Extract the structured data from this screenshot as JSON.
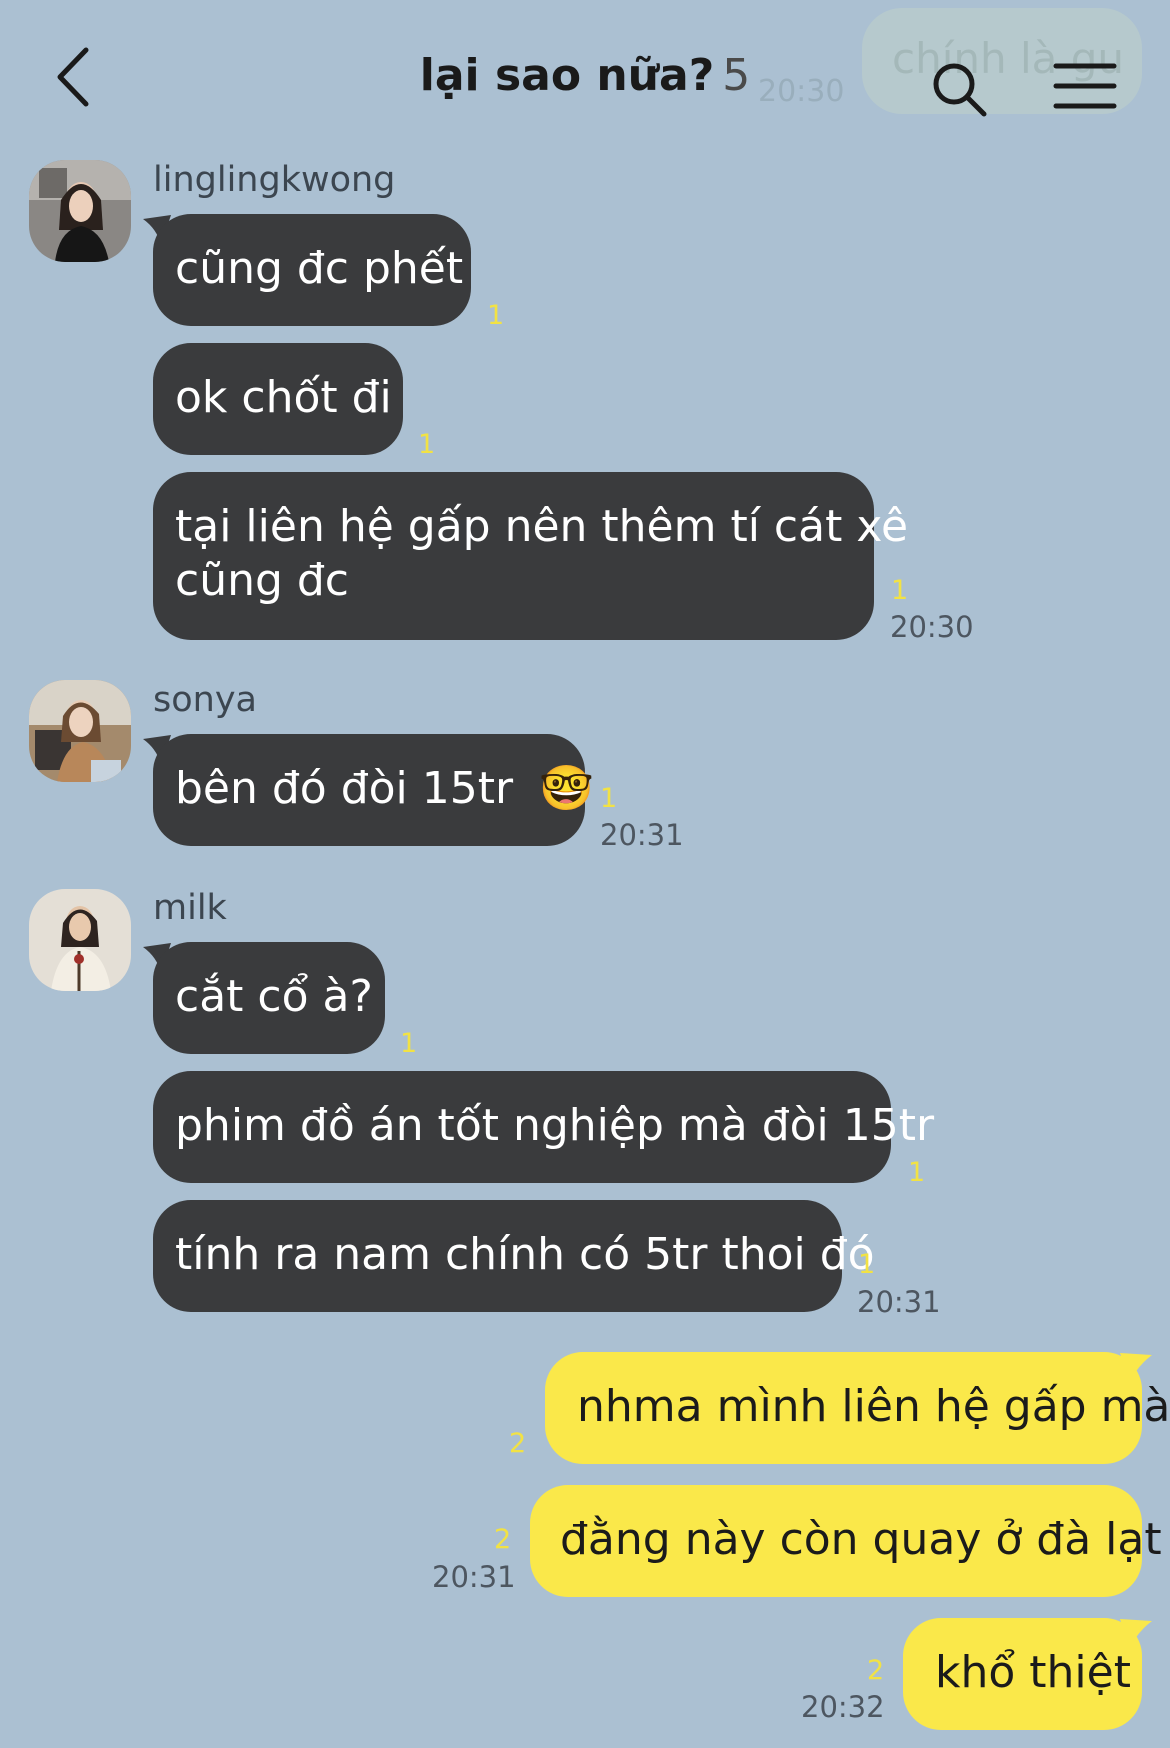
{
  "header": {
    "title": "lại sao nữa?",
    "member_count": "5",
    "back_icon": "chevron-left-icon",
    "search_icon": "search-icon",
    "menu_icon": "hamburger-menu-icon"
  },
  "overlay": {
    "preview_text": "chính là gu",
    "preview_time": "20:30"
  },
  "colors": {
    "background": "#abc0d2",
    "incoming_bubble": "#3a3b3d",
    "outgoing_bubble": "#fae84a",
    "unread_count": "#f2e244"
  },
  "groups": [
    {
      "sender": "linglingkwong",
      "messages": [
        {
          "text": "cũng đc phết",
          "unread": "1"
        },
        {
          "text": "ok chốt đi",
          "unread": "1"
        },
        {
          "text_line1": "tại liên hệ gấp nên thêm tí cát xê",
          "text_line2": "cũng đc",
          "unread": "1",
          "time": "20:30"
        }
      ]
    },
    {
      "sender": "sonya",
      "messages": [
        {
          "text": "bên đó đòi 15tr",
          "emoji": "🤓",
          "unread": "1",
          "time": "20:31"
        }
      ]
    },
    {
      "sender": "milk",
      "messages": [
        {
          "text": "cắt cổ à?",
          "unread": "1"
        },
        {
          "text": "phim đồ án tốt nghiệp mà đòi 15tr",
          "unread": "1"
        },
        {
          "text": "tính ra nam chính có 5tr thoi đó",
          "unread": "1",
          "time": "20:31"
        }
      ]
    }
  ],
  "outgoing": [
    {
      "text": "nhma mình liên hệ gấp mà",
      "unread": "2"
    },
    {
      "text": "đằng này còn quay ở đà lạt",
      "unread": "2",
      "time": "20:31"
    },
    {
      "text": "khổ thiệt",
      "unread": "2",
      "time": "20:32"
    }
  ]
}
